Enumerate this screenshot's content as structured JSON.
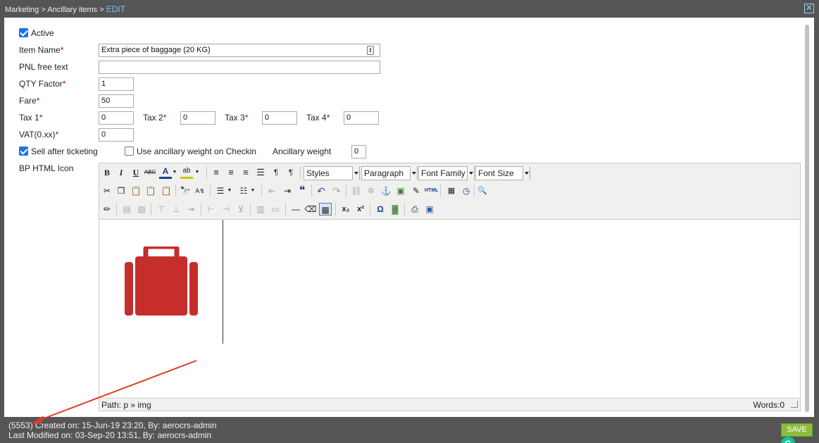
{
  "breadcrumb": {
    "part1": "Marketing",
    "sep": ">",
    "part2": "Ancillary items",
    "current": "EDIT"
  },
  "close_glyph": "✕",
  "form": {
    "active": {
      "label": "Active",
      "checked": true
    },
    "item_name": {
      "label": "Item Name",
      "value": "Extra piece of baggage (20 KG)"
    },
    "pnl_free_text": {
      "label": "PNL free text",
      "value": ""
    },
    "qty_factor": {
      "label": "QTY Factor",
      "value": "1"
    },
    "fare": {
      "label": "Fare",
      "value": "50"
    },
    "tax1": {
      "label": "Tax 1",
      "value": "0"
    },
    "tax2": {
      "label": "Tax 2",
      "value": "0"
    },
    "tax3": {
      "label": "Tax 3",
      "value": "0"
    },
    "tax4": {
      "label": "Tax 4",
      "value": "0"
    },
    "vat": {
      "label": "VAT(0.xx)",
      "value": "0"
    },
    "sell_after_ticketing": {
      "label": "Sell after ticketing",
      "checked": true
    },
    "use_ancillary_weight": {
      "label": "Use ancillary weight on Checkin",
      "checked": false
    },
    "ancillary_weight": {
      "label": "Ancillary weight",
      "value": "0"
    },
    "bp_html_icon": {
      "label": "BP HTML Icon"
    },
    "required_mark": "*"
  },
  "editor": {
    "selects": {
      "styles": "Styles",
      "paragraph": "Paragraph",
      "font_family": "Font Family",
      "font_size": "Font Size"
    },
    "glyphs": {
      "bold": "B",
      "italic": "I",
      "underline": "U",
      "strike": "ABC",
      "text_color": "A",
      "highlight": "ab",
      "html": "HTML",
      "quote": "❝",
      "omega": "Ω",
      "undo": "↶",
      "redo": "↷",
      "sub": "x₂",
      "sup": "x²",
      "anchor": "⚓",
      "clock": "◷",
      "search": "🔍"
    },
    "path": "Path: p » img",
    "words": "Words:0",
    "grammarly": "G"
  },
  "footer": {
    "created": "(5553) Created on: 15-Jun-19 23:20, By: aerocrs-admin",
    "modified": "Last Modified on: 03-Sep-20 13:51, By: aerocrs-admin",
    "save_label": "SAVE"
  },
  "colors": {
    "accent": "#1a73e8",
    "save": "#8bbd3c",
    "required": "#cc0000",
    "bag": "#c62e2c",
    "arrow": "#e03c28"
  },
  "icons": [
    "close-icon",
    "luggage-icon",
    "grammarly-icon",
    "checkbox-icon"
  ]
}
